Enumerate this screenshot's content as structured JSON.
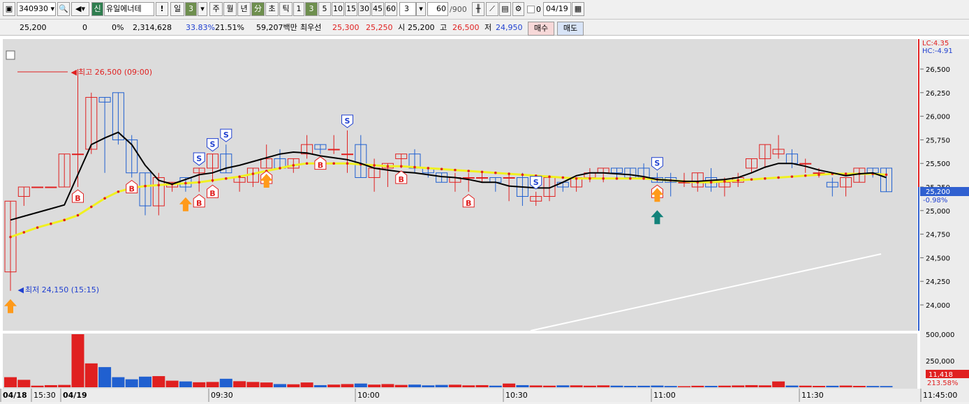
{
  "toolbar": {
    "code": "340930",
    "badge": "신",
    "name": "유일에너테",
    "bang": "!",
    "period_il": "일",
    "period_num": "3",
    "periods": [
      "주",
      "월",
      "년"
    ],
    "bun": "分",
    "cho": "초",
    "tick": "틱",
    "minutes": [
      "1",
      "3",
      "5",
      "10",
      "15",
      "30",
      "45",
      "60"
    ],
    "minutes_selected": "3",
    "count": "3",
    "count_view": "60",
    "count_total": "/900",
    "zero": "0",
    "date": "04/19"
  },
  "quote": {
    "price": "25,200",
    "change": "0",
    "rate": "0%",
    "volume": "2,314,628",
    "pct1": "33.83%",
    "pct2": "21.51%",
    "amount": "59,207백만",
    "best_label": "최우선",
    "ask": "25,300",
    "bid": "25,250",
    "open_label": "시",
    "open": "25,200",
    "high_label": "고",
    "high": "26,500",
    "low_label": "저",
    "low": "24,950",
    "buy": "매수",
    "sell": "매도"
  },
  "chart_data": {
    "type": "candlestick",
    "price_range": [
      23800,
      26950
    ],
    "y_ticks": [
      "26,500",
      "26,250",
      "26,000",
      "25,750",
      "25,500",
      "25,250",
      "25,000",
      "24,750",
      "24,500",
      "24,250",
      "24,000"
    ],
    "lc": "LC:4.35",
    "hc": "HC:-4.91",
    "current_price": "25,200",
    "current_change": "-0.98%",
    "high_note": "최고 26,500 (09:00)",
    "low_note": "최저 24,150 (15:15)",
    "volume_ticks": [
      "500,000",
      "250,000"
    ],
    "volume_current": "11,418",
    "volume_pct": "213.58%",
    "x_labels": [
      "04/18",
      "15:30",
      "04/19",
      "09:30",
      "10:00",
      "10:30",
      "11:00",
      "11:30",
      "11:45:00"
    ],
    "signals_b": "B",
    "signals_s": "S",
    "candles": [
      {
        "o": 24350,
        "h": 25100,
        "l": 24150,
        "c": 25100,
        "v": 95000
      },
      {
        "o": 25150,
        "h": 25250,
        "l": 25050,
        "c": 25250,
        "v": 70000
      },
      {
        "o": 25250,
        "h": 25250,
        "l": 25250,
        "c": 25250,
        "v": 15000
      },
      {
        "o": 25250,
        "h": 25250,
        "l": 25250,
        "c": 25250,
        "v": 20000
      },
      {
        "o": 25250,
        "h": 25600,
        "l": 25250,
        "c": 25600,
        "v": 22000
      },
      {
        "o": 25600,
        "h": 26500,
        "l": 25250,
        "c": 25600,
        "v": 500000
      },
      {
        "o": 25650,
        "h": 26250,
        "l": 25600,
        "c": 26200,
        "v": 225000
      },
      {
        "o": 26200,
        "h": 26200,
        "l": 25400,
        "c": 26150,
        "v": 190000
      },
      {
        "o": 26250,
        "h": 26250,
        "l": 25700,
        "c": 25750,
        "v": 95000
      },
      {
        "o": 25750,
        "h": 25800,
        "l": 25350,
        "c": 25400,
        "v": 75000
      },
      {
        "o": 25400,
        "h": 25400,
        "l": 24950,
        "c": 25050,
        "v": 100000
      },
      {
        "o": 25050,
        "h": 25400,
        "l": 24950,
        "c": 25350,
        "v": 105000
      },
      {
        "o": 25250,
        "h": 25300,
        "l": 25200,
        "c": 25300,
        "v": 62000
      },
      {
        "o": 25350,
        "h": 25350,
        "l": 25200,
        "c": 25250,
        "v": 55000
      },
      {
        "o": 25400,
        "h": 25450,
        "l": 25200,
        "c": 25450,
        "v": 47000
      },
      {
        "o": 25450,
        "h": 25600,
        "l": 25300,
        "c": 25600,
        "v": 50000
      },
      {
        "o": 25600,
        "h": 25700,
        "l": 25400,
        "c": 25400,
        "v": 80000
      },
      {
        "o": 25300,
        "h": 25350,
        "l": 25200,
        "c": 25350,
        "v": 57000
      },
      {
        "o": 25300,
        "h": 25450,
        "l": 25250,
        "c": 25450,
        "v": 50000
      },
      {
        "o": 25450,
        "h": 25700,
        "l": 25450,
        "c": 25550,
        "v": 45000
      },
      {
        "o": 25550,
        "h": 25650,
        "l": 25450,
        "c": 25450,
        "v": 30000
      },
      {
        "o": 25450,
        "h": 25550,
        "l": 25400,
        "c": 25550,
        "v": 28000
      },
      {
        "o": 25600,
        "h": 25800,
        "l": 25550,
        "c": 25700,
        "v": 45000
      },
      {
        "o": 25700,
        "h": 25700,
        "l": 25600,
        "c": 25650,
        "v": 20000
      },
      {
        "o": 25650,
        "h": 25800,
        "l": 25600,
        "c": 25650,
        "v": 25000
      },
      {
        "o": 25600,
        "h": 25850,
        "l": 25400,
        "c": 25600,
        "v": 30000
      },
      {
        "o": 25700,
        "h": 25800,
        "l": 25350,
        "c": 25350,
        "v": 35000
      },
      {
        "o": 25350,
        "h": 25550,
        "l": 25200,
        "c": 25450,
        "v": 25000
      },
      {
        "o": 25450,
        "h": 25500,
        "l": 25250,
        "c": 25500,
        "v": 30000
      },
      {
        "o": 25550,
        "h": 25600,
        "l": 25450,
        "c": 25600,
        "v": 22000
      },
      {
        "o": 25600,
        "h": 25650,
        "l": 25400,
        "c": 25450,
        "v": 25000
      },
      {
        "o": 25450,
        "h": 25450,
        "l": 25350,
        "c": 25400,
        "v": 18000
      },
      {
        "o": 25400,
        "h": 25400,
        "l": 25300,
        "c": 25300,
        "v": 22000
      },
      {
        "o": 25300,
        "h": 25400,
        "l": 25200,
        "c": 25350,
        "v": 24000
      },
      {
        "o": 25350,
        "h": 25400,
        "l": 25200,
        "c": 25350,
        "v": 18000
      },
      {
        "o": 25350,
        "h": 25400,
        "l": 25300,
        "c": 25350,
        "v": 20000
      },
      {
        "o": 25350,
        "h": 25350,
        "l": 25200,
        "c": 25300,
        "v": 15000
      },
      {
        "o": 25350,
        "h": 25400,
        "l": 25100,
        "c": 25350,
        "v": 35000
      },
      {
        "o": 25350,
        "h": 25400,
        "l": 25050,
        "c": 25150,
        "v": 20000
      },
      {
        "o": 25100,
        "h": 25200,
        "l": 25050,
        "c": 25150,
        "v": 17000
      },
      {
        "o": 25150,
        "h": 25350,
        "l": 25100,
        "c": 25350,
        "v": 15000
      },
      {
        "o": 25300,
        "h": 25300,
        "l": 25200,
        "c": 25250,
        "v": 18000
      },
      {
        "o": 25250,
        "h": 25350,
        "l": 25200,
        "c": 25350,
        "v": 18000
      },
      {
        "o": 25350,
        "h": 25450,
        "l": 25300,
        "c": 25400,
        "v": 15000
      },
      {
        "o": 25400,
        "h": 25450,
        "l": 25300,
        "c": 25450,
        "v": 18000
      },
      {
        "o": 25450,
        "h": 25450,
        "l": 25350,
        "c": 25400,
        "v": 15000
      },
      {
        "o": 25450,
        "h": 25450,
        "l": 25350,
        "c": 25350,
        "v": 13000
      },
      {
        "o": 25450,
        "h": 25500,
        "l": 25350,
        "c": 25350,
        "v": 14000
      },
      {
        "o": 25350,
        "h": 25400,
        "l": 25300,
        "c": 25300,
        "v": 16000
      },
      {
        "o": 25350,
        "h": 25400,
        "l": 25150,
        "c": 25300,
        "v": 12000
      },
      {
        "o": 25300,
        "h": 25400,
        "l": 25250,
        "c": 25300,
        "v": 10000
      },
      {
        "o": 25250,
        "h": 25400,
        "l": 25200,
        "c": 25400,
        "v": 14000
      },
      {
        "o": 25350,
        "h": 25450,
        "l": 25200,
        "c": 25250,
        "v": 13000
      },
      {
        "o": 25250,
        "h": 25350,
        "l": 25150,
        "c": 25300,
        "v": 15000
      },
      {
        "o": 25300,
        "h": 25400,
        "l": 25250,
        "c": 25350,
        "v": 17000
      },
      {
        "o": 25450,
        "h": 25550,
        "l": 25400,
        "c": 25550,
        "v": 20000
      },
      {
        "o": 25550,
        "h": 25700,
        "l": 25450,
        "c": 25700,
        "v": 18000
      },
      {
        "o": 25600,
        "h": 25800,
        "l": 25550,
        "c": 25650,
        "v": 55000
      },
      {
        "o": 25600,
        "h": 25650,
        "l": 25450,
        "c": 25500,
        "v": 16000
      },
      {
        "o": 25500,
        "h": 25550,
        "l": 25400,
        "c": 25500,
        "v": 15000
      },
      {
        "o": 25400,
        "h": 25450,
        "l": 25350,
        "c": 25400,
        "v": 13000
      },
      {
        "o": 25300,
        "h": 25350,
        "l": 25150,
        "c": 25250,
        "v": 14000
      },
      {
        "o": 25250,
        "h": 25350,
        "l": 25150,
        "c": 25350,
        "v": 16000
      },
      {
        "o": 25300,
        "h": 25450,
        "l": 25300,
        "c": 25450,
        "v": 13000
      },
      {
        "o": 25450,
        "h": 25450,
        "l": 25350,
        "c": 25400,
        "v": 12000
      },
      {
        "o": 25450,
        "h": 25450,
        "l": 25200,
        "c": 25200,
        "v": 11418
      }
    ],
    "ma_black": [
      24900,
      24940,
      24980,
      25020,
      25060,
      25380,
      25700,
      25770,
      25830,
      25700,
      25480,
      25320,
      25280,
      25330,
      25380,
      25400,
      25450,
      25480,
      25520,
      25560,
      25600,
      25620,
      25610,
      25580,
      25560,
      25540,
      25500,
      25450,
      25430,
      25410,
      25400,
      25380,
      25360,
      25350,
      25330,
      25300,
      25300,
      25260,
      25250,
      25240,
      25240,
      25300,
      25370,
      25400,
      25400,
      25390,
      25380,
      25360,
      25330,
      25320,
      25310,
      25310,
      25320,
      25330,
      25350,
      25400,
      25460,
      25500,
      25500,
      25470,
      25430,
      25400,
      25370,
      25390,
      25400,
      25350
    ],
    "ma_yellow": [
      24720,
      24770,
      24820,
      24860,
      24900,
      24950,
      25040,
      25130,
      25200,
      25240,
      25260,
      25270,
      25280,
      25290,
      25300,
      25320,
      25340,
      25360,
      25390,
      25420,
      25450,
      25480,
      25500,
      25500,
      25500,
      25500,
      25490,
      25480,
      25470,
      25470,
      25460,
      25450,
      25440,
      25430,
      25420,
      25410,
      25400,
      25390,
      25380,
      25370,
      25360,
      25350,
      25340,
      25340,
      25340,
      25340,
      25340,
      25340,
      25330,
      25320,
      25310,
      25300,
      25300,
      25310,
      25320,
      25330,
      25340,
      25350,
      25360,
      25370,
      25380,
      25390,
      25390,
      25390,
      25390,
      25380
    ],
    "buy_marks": [
      5,
      9,
      14,
      15,
      19,
      23,
      29,
      34,
      48
    ],
    "sell_marks": [
      14,
      15,
      16,
      25,
      39,
      48
    ],
    "up_arrows": [
      0,
      13,
      19,
      48
    ],
    "teal_arrows": [
      48
    ]
  },
  "colors": {
    "up": "#e02020",
    "down": "#2060d0",
    "panel": "#dcdcdc",
    "ma": "#000000",
    "ma2": "#f0f020"
  }
}
